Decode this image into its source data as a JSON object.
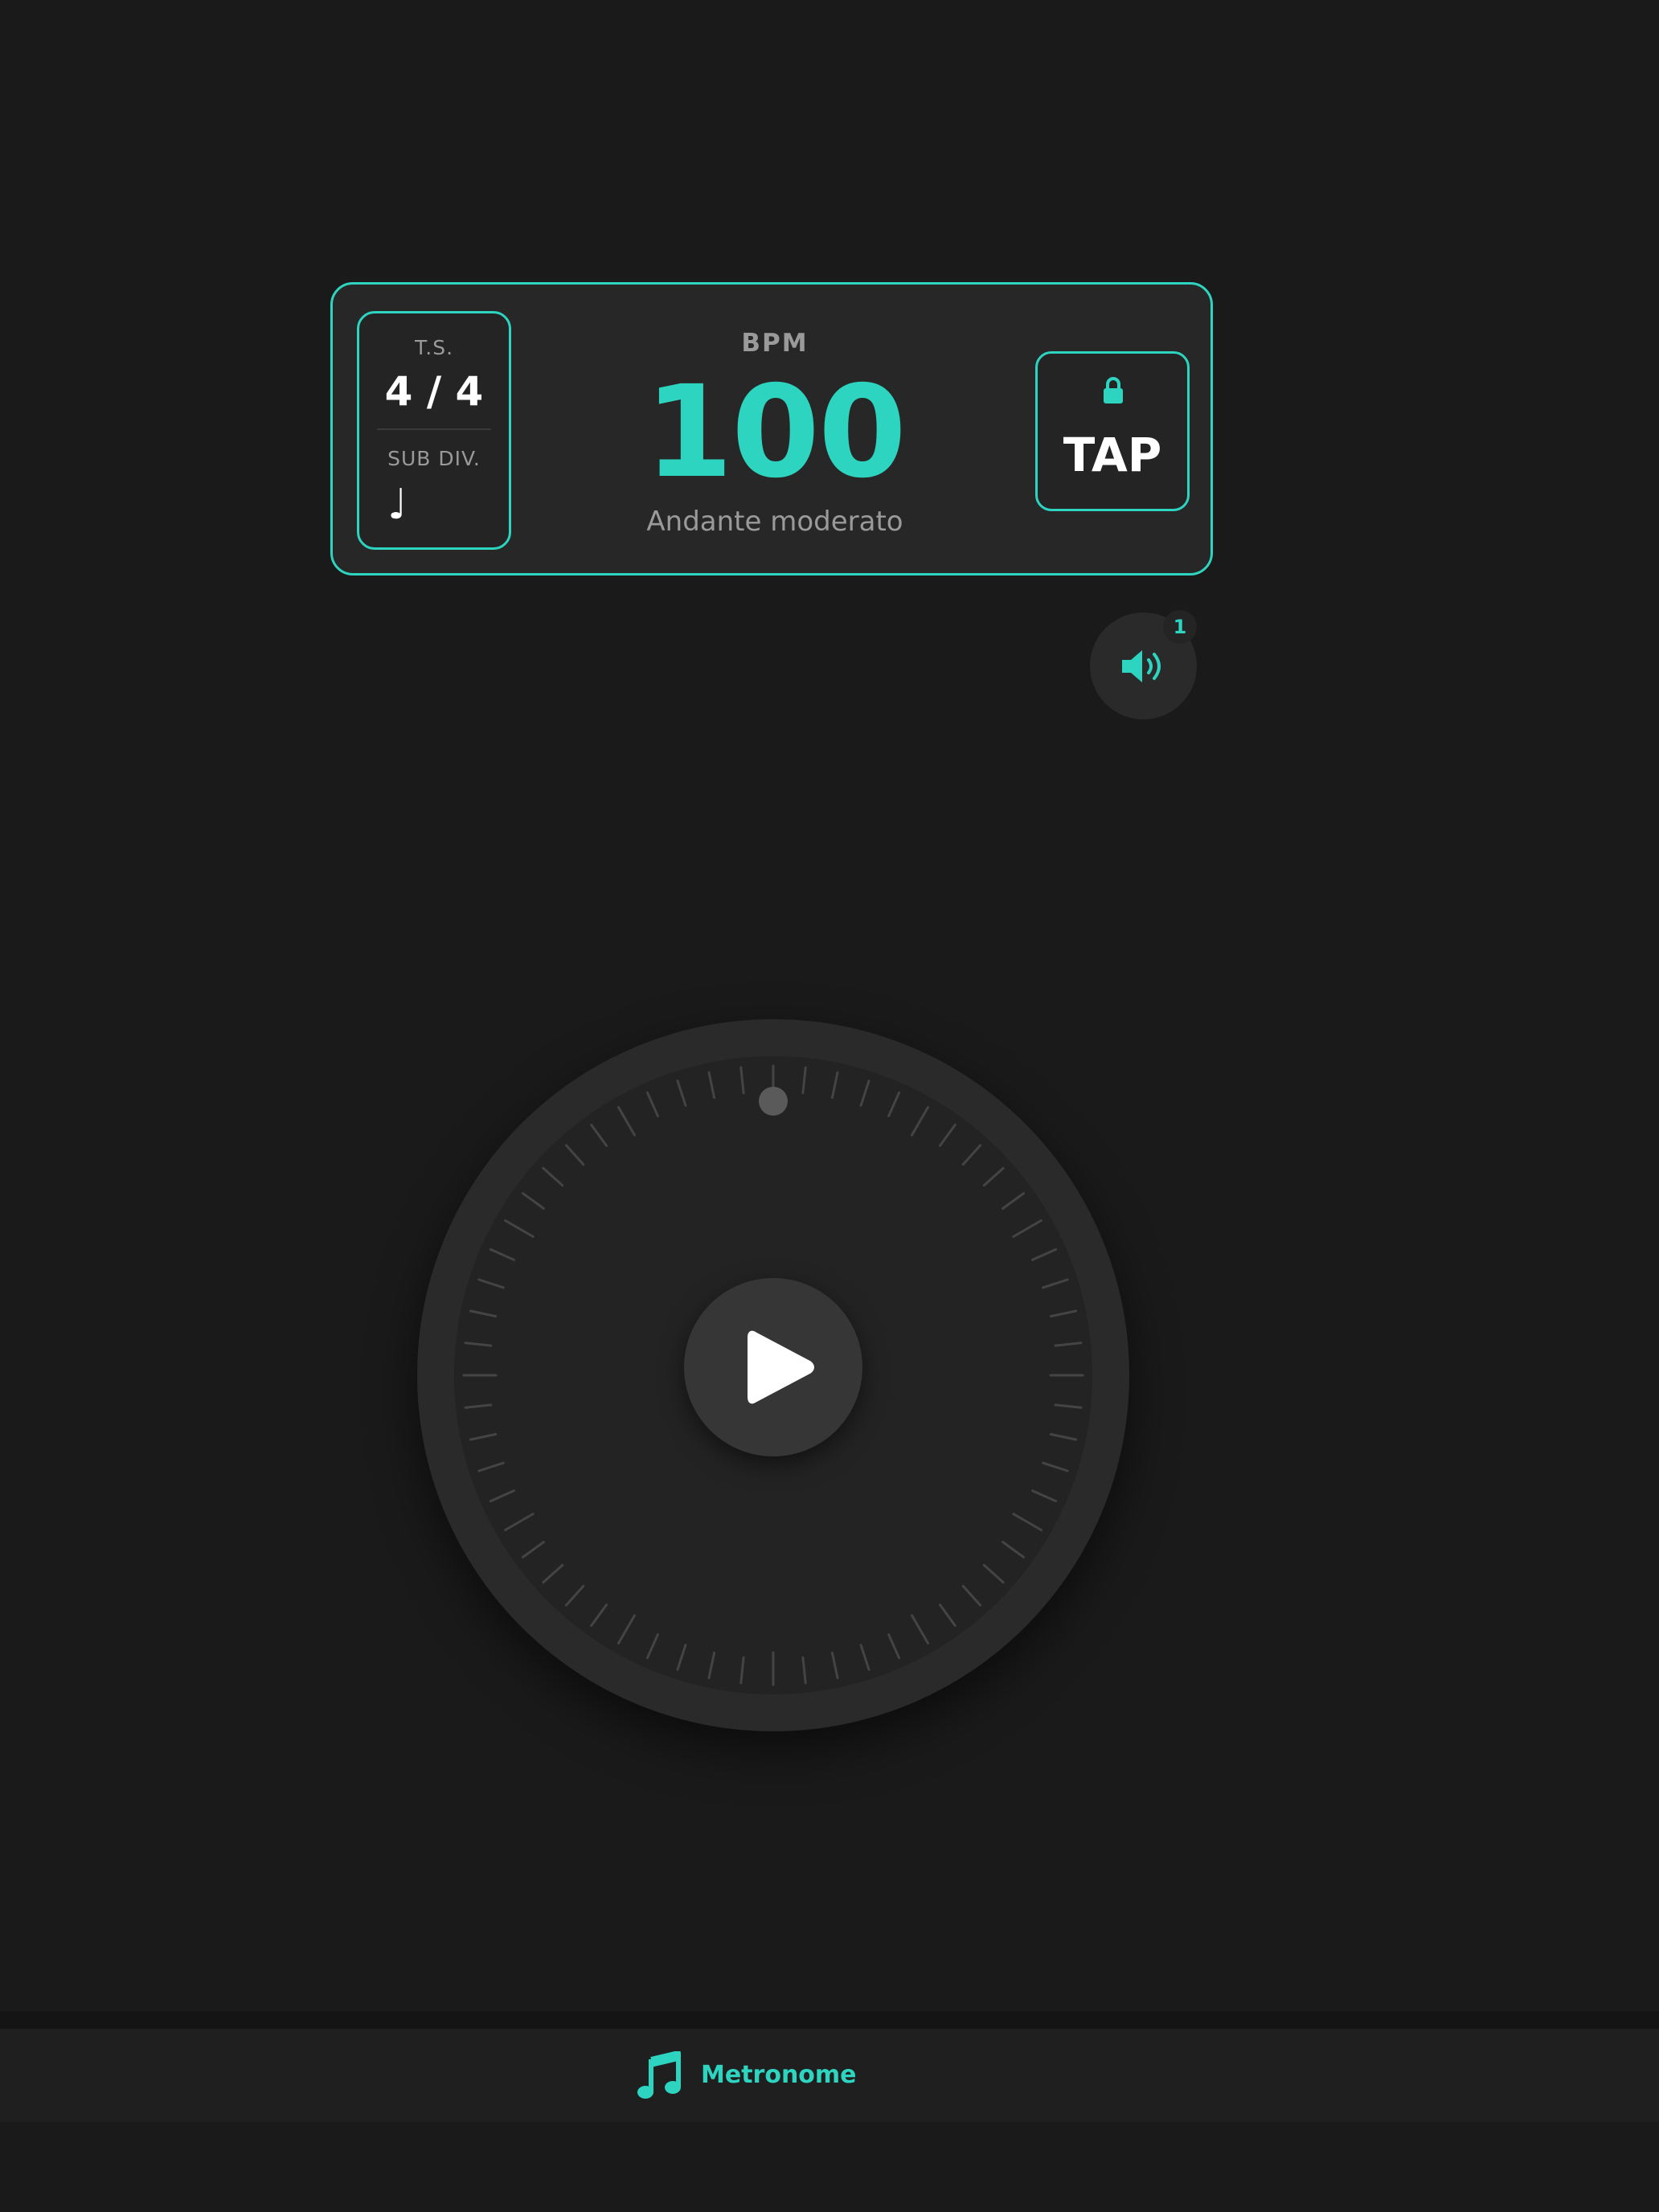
{
  "colors": {
    "accent": "#2dd4bf",
    "background": "#1a1a1a",
    "panel": "#272727",
    "muted_text": "#9a9a9a"
  },
  "panel": {
    "time_signature": {
      "label": "T.S.",
      "value": "4 / 4"
    },
    "subdivision": {
      "label": "SUB DIV.",
      "value": "♩"
    },
    "bpm": {
      "label": "BPM",
      "value": "100",
      "tempo_name": "Andante moderato"
    },
    "tap": {
      "label": "TAP",
      "icon": "lock-icon"
    }
  },
  "sound": {
    "icon": "speaker-icon",
    "badge": "1"
  },
  "dial": {
    "play_icon": "play-icon",
    "beat_indicator_icon": "beat-dot"
  },
  "nav": {
    "items": [
      {
        "label": "Metronome",
        "icon": "music-note-icon",
        "active": true
      }
    ]
  }
}
